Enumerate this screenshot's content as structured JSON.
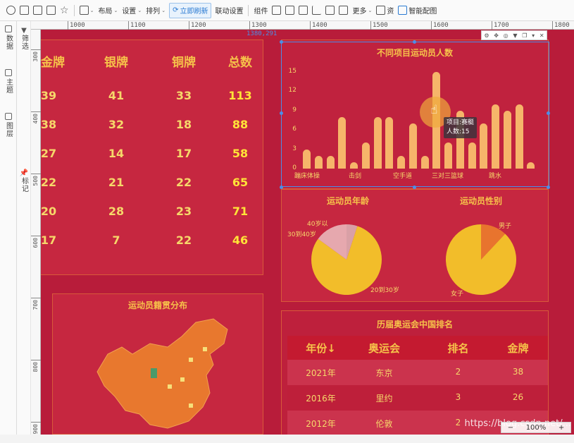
{
  "toolbar": {
    "layout": "布局",
    "settings": "设置",
    "arrange": "排列",
    "refresh": "立即刷新",
    "linkage": "联动设置",
    "components": "组件",
    "more": "更多",
    "assets": "资",
    "smart": "智能配图"
  },
  "left_panel": {
    "data": "数据",
    "filter": "筛选",
    "theme": "主题",
    "layer": "图层",
    "mark": "标记"
  },
  "ruler": {
    "top": [
      "1000",
      "1100",
      "1200",
      "1300",
      "1400",
      "1500",
      "1600",
      "1700",
      "1800"
    ],
    "left": [
      "300",
      "400",
      "500",
      "600",
      "700",
      "800",
      "900"
    ],
    "coord": "1380,291"
  },
  "medals": {
    "headers": [
      "金牌",
      "银牌",
      "铜牌",
      "总数"
    ],
    "rows": [
      [
        "39",
        "41",
        "33",
        "113"
      ],
      [
        "38",
        "32",
        "18",
        "88"
      ],
      [
        "27",
        "14",
        "17",
        "58"
      ],
      [
        "22",
        "21",
        "22",
        "65"
      ],
      [
        "20",
        "28",
        "23",
        "71"
      ],
      [
        "17",
        "7",
        "22",
        "46"
      ]
    ]
  },
  "bar_chart": {
    "title": "不同项目运动员人数",
    "y_ticks": [
      "15",
      "12",
      "9",
      "6",
      "3",
      "0"
    ],
    "x_labels": [
      "蹦床体操",
      "击剑",
      "空手道",
      "三对三篮球",
      "跳水"
    ],
    "tooltip": {
      "line1": "项目:赛艇",
      "line2": "人数:15"
    }
  },
  "chart_data": [
    {
      "type": "bar",
      "title": "不同项目运动员人数",
      "ylim": [
        0,
        15
      ],
      "values": [
        3,
        2,
        2,
        8,
        1,
        4,
        8,
        8,
        2,
        7,
        2,
        15,
        4,
        9,
        4,
        7,
        10,
        9,
        10,
        1
      ],
      "xticklabels": [
        "蹦床体操",
        "击剑",
        "空手道",
        "三对三篮球",
        "跳水"
      ]
    },
    {
      "type": "pie",
      "title": "运动员年龄",
      "slices": [
        {
          "label": "20到30岁",
          "value": 80
        },
        {
          "label": "30到40岁",
          "value": 15
        },
        {
          "label": "40岁以",
          "value": 5
        }
      ]
    },
    {
      "type": "pie",
      "title": "运动员性别",
      "slices": [
        {
          "label": "女子",
          "value": 88
        },
        {
          "label": "男子",
          "value": 12
        }
      ]
    }
  ],
  "age_pie": {
    "title": "运动员年龄",
    "l1": "40岁以",
    "l2": "30到40岁",
    "l3": "20到30岁"
  },
  "gender_pie": {
    "title": "运动员性别",
    "l1": "男子",
    "l2": "女子"
  },
  "map": {
    "title": "运动员籍贯分布"
  },
  "ranking": {
    "title": "历届奥运会中国排名",
    "headers": [
      "年份↓",
      "奥运会",
      "排名",
      "金牌"
    ],
    "rows": [
      [
        "2021年",
        "东京",
        "2",
        "38"
      ],
      [
        "2016年",
        "里约",
        "3",
        "26"
      ],
      [
        "2012年",
        "伦敦",
        "2",
        ""
      ]
    ]
  },
  "watermark": "https://blog.csdn.net/...",
  "zoom": "100%",
  "colors": {
    "bg": "#b81c3a",
    "gold": "#f6c24a",
    "bar": "#f6b56a",
    "select": "#4b8ee8"
  }
}
